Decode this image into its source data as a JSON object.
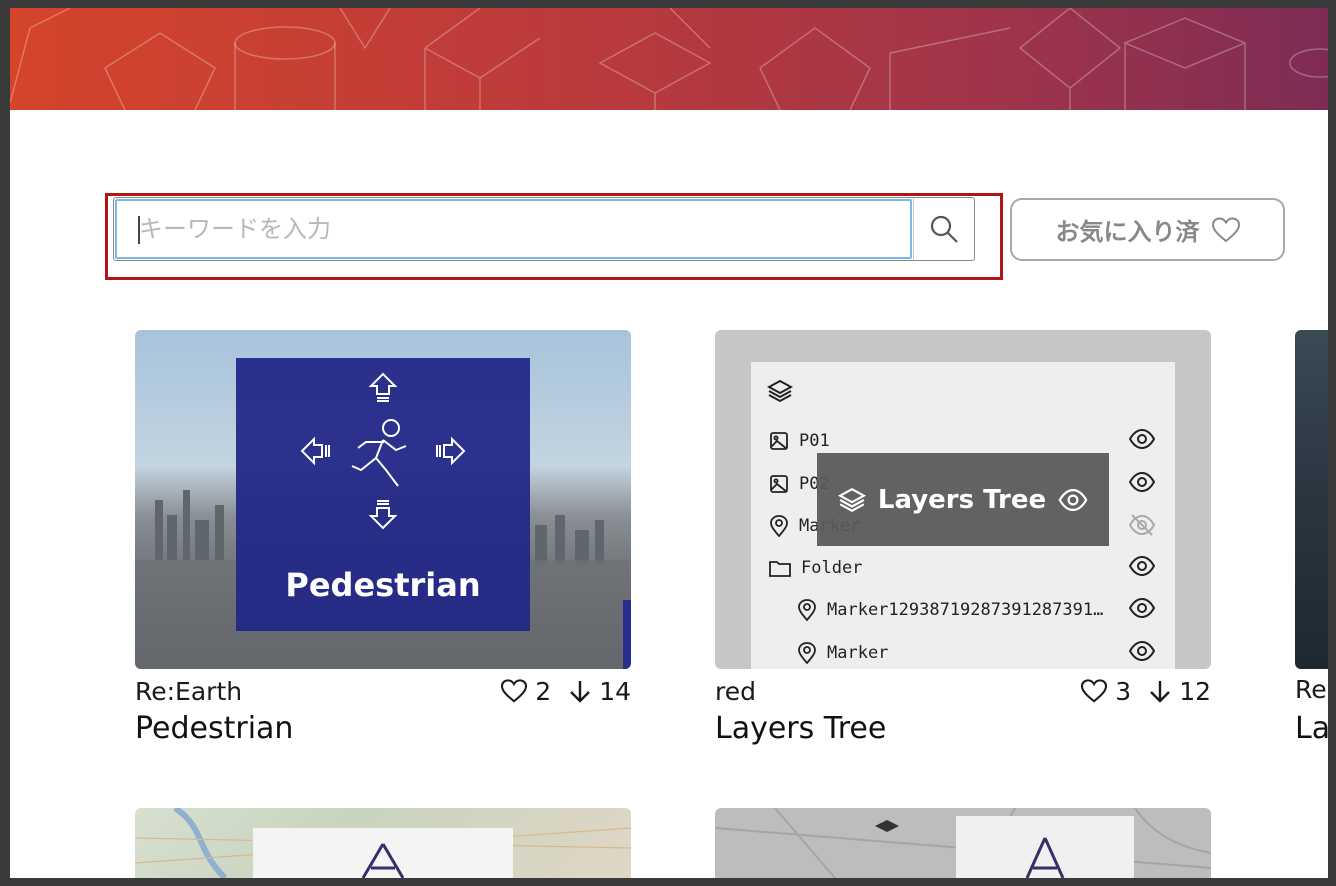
{
  "search": {
    "placeholder": "キーワードを入力"
  },
  "favorites_button": {
    "label": "お気に入り済"
  },
  "cards": [
    {
      "overlay_label": "Pedestrian",
      "author": "Re:Earth",
      "likes": "2",
      "downloads": "14",
      "title": "Pedestrian"
    },
    {
      "overlay_label": "Layers Tree",
      "author": "red",
      "likes": "3",
      "downloads": "12",
      "title": "Layers Tree",
      "layers": [
        {
          "icon": "image-icon",
          "name": "P01",
          "visible": true
        },
        {
          "icon": "image-icon",
          "name": "P02",
          "visible": true
        },
        {
          "icon": "marker-icon",
          "name": "Marker",
          "visible": false
        },
        {
          "icon": "folder-icon",
          "name": "Folder",
          "visible": true
        },
        {
          "icon": "marker-icon",
          "name": "Marker12938719287391287391...",
          "visible": true
        },
        {
          "icon": "marker-icon",
          "name": "Marker",
          "visible": true
        }
      ]
    },
    {
      "author": "Re",
      "title": "La"
    }
  ],
  "colors": {
    "highlight": "#b11616",
    "input_focus": "#7ab8f0",
    "pedestrian_overlay": "#232887",
    "banner_start": "#d5442b",
    "banner_end": "#7e2c55"
  }
}
